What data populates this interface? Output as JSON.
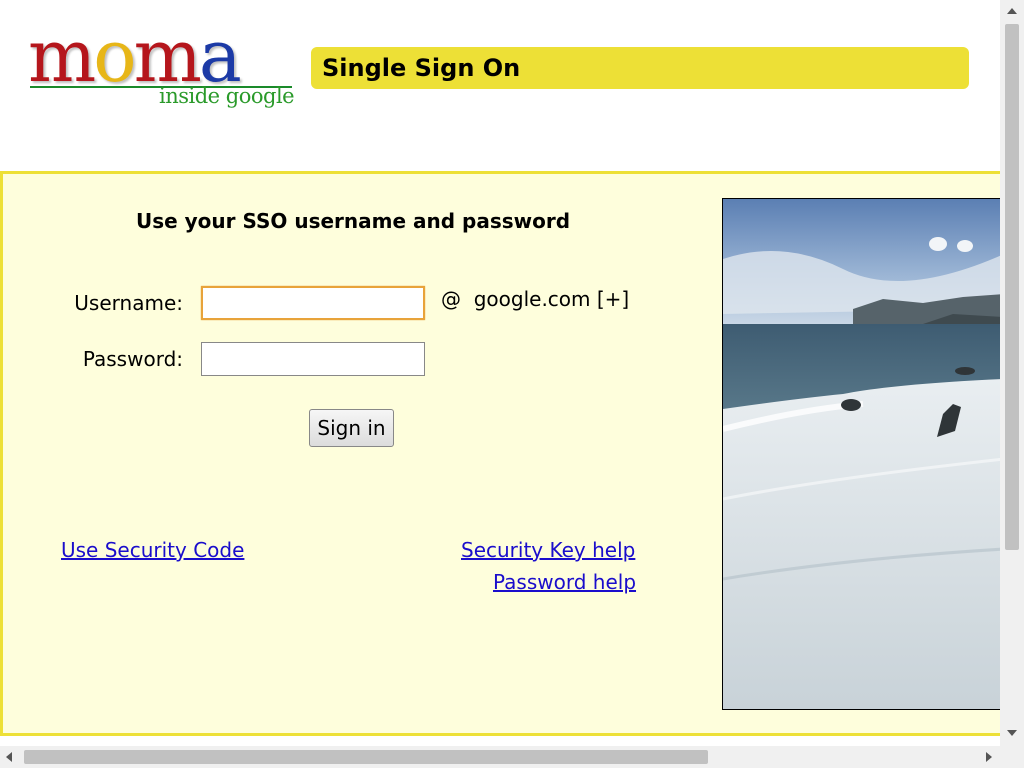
{
  "logo": {
    "letters": [
      {
        "char": "m",
        "color": "#b5161c"
      },
      {
        "char": "o",
        "color": "#e7b618"
      },
      {
        "char": "m",
        "color": "#b5161c"
      },
      {
        "char": "a",
        "color": "#1c3aa6"
      }
    ],
    "subtitle": "inside google"
  },
  "header": {
    "title": "Single Sign On"
  },
  "form": {
    "heading": "Use your SSO username and password",
    "username_label": "Username:",
    "username_value": "",
    "password_label": "Password:",
    "password_value": "",
    "domain_suffix": "@  google.com [+]",
    "submit_label": "Sign in"
  },
  "links": {
    "security_code": "Use Security Code",
    "security_key_help": "Security Key help",
    "password_help": "Password help"
  },
  "colors": {
    "accent_yellow": "#ede036",
    "panel_bg": "#fefedc",
    "link": "#1a0dcc",
    "focus_ring": "#e8a33a"
  },
  "icons": [
    "coastline-photo",
    "scroll-up-icon",
    "scroll-down-icon",
    "scroll-left-icon",
    "scroll-right-icon"
  ]
}
